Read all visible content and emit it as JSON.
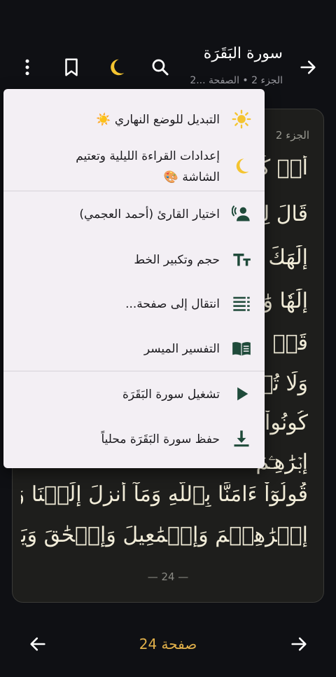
{
  "header": {
    "title": "سورة البَقَرَة",
    "subtitle": "الجزء 2 • الصفحة ...2",
    "icons": [
      "arrow-forward-icon",
      "search-icon",
      "moon-icon",
      "bookmark-icon",
      "more-vert-icon"
    ]
  },
  "page": {
    "juz_label": "الجزء 2",
    "verses": [
      "أَمۡ كُنتُ",
      "قَالَ لِبَنِ",
      "إِلَٰهَكَ وَ",
      "إِلَٰهٗا وَٰحِ",
      "قَدۡ خَلَتۡ",
      "وَلَا تُسۡ",
      "كُونُواْ هُ",
      "إِبۡرَٰهِـۧمَ",
      "قُولُوٓاْ ءَامَنَّا بِٱللَّهِ وَمَآ أُنزِلَ إِلَيۡنَا وَمَآ أُنزِلَ إِلَىٰٓ",
      "إِبۡرَٰهِـۧمَ وَإِسۡمَٰعِيلَ وَإِسۡحَٰقَ وَيَعۡقُوبَ"
    ],
    "page_footer": "— 24 —"
  },
  "bottom_nav": {
    "page_label": "صفحة 24",
    "icons": [
      "arrow-back-icon",
      "arrow-forward-icon"
    ]
  },
  "menu": {
    "items": [
      {
        "label": "التبديل للوضع النهاري ☀️",
        "icon": "sun-icon"
      },
      {
        "label": "إعدادات القراءة الليلية وتعتيم",
        "label2": "الشاشة 🎨",
        "icon": "moon-icon"
      },
      {
        "label": "اختيار القارئ (أحمد العجمي)",
        "icon": "voice-icon"
      },
      {
        "label": "حجم وتكبير الخط",
        "icon": "text-size-icon"
      },
      {
        "label": "انتقال إلى صفحة...",
        "icon": "list-numbered-icon"
      },
      {
        "label": "التفسير الميسر",
        "icon": "book-icon"
      },
      {
        "label": "تشغيل سورة البَقَرَة",
        "icon": "play-icon"
      },
      {
        "label": "حفظ سورة البَقَرَة محلياً",
        "icon": "download-icon"
      }
    ]
  },
  "colors": {
    "background": "#0f1014",
    "card": "#1e1e1c",
    "accent": "#e1b04a",
    "menu_bg": "#f3eff4",
    "menu_icon": "#1f4a3a",
    "sun": "#f4c430"
  }
}
